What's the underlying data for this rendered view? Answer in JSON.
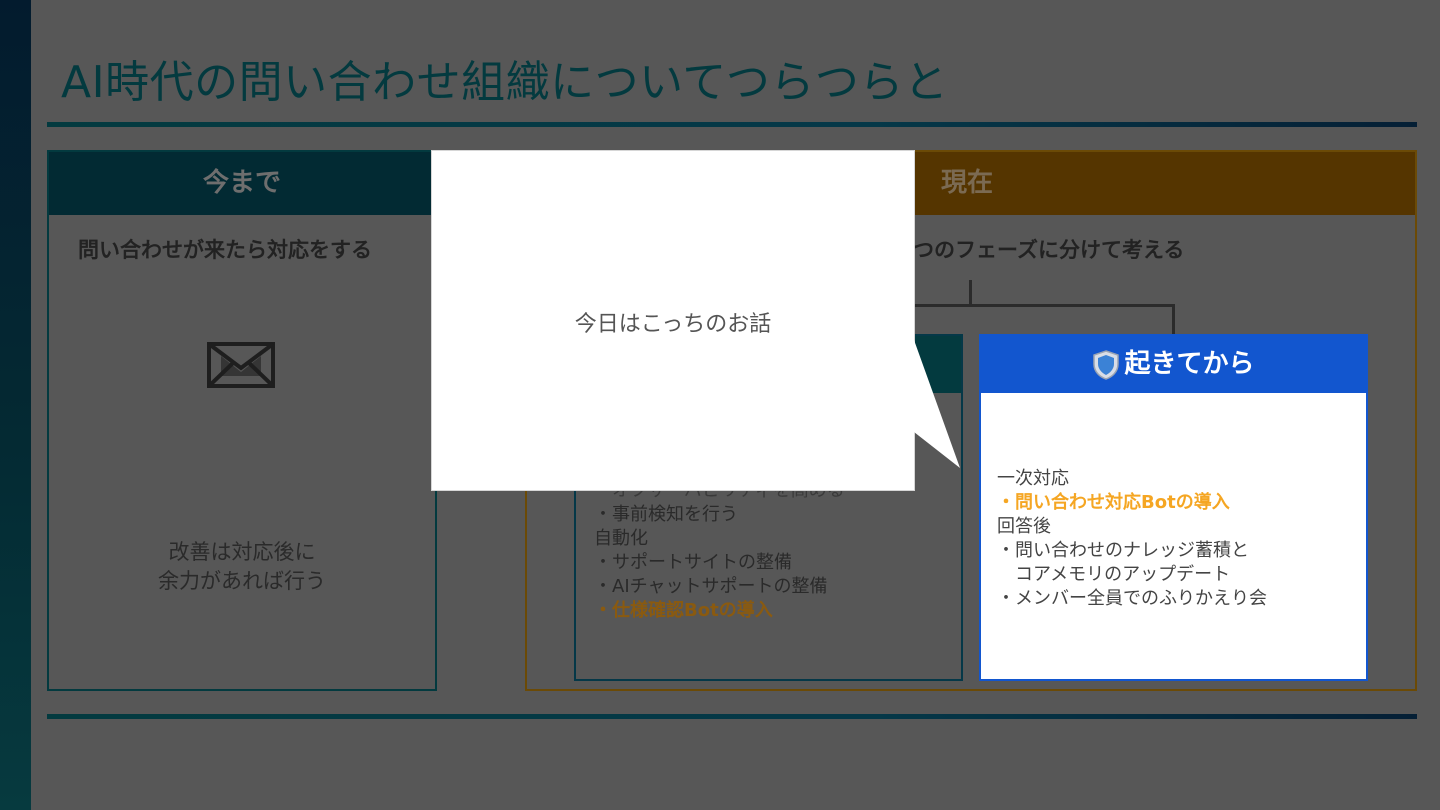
{
  "slide": {
    "title": "AI時代の問い合わせ組織についてつらつらと"
  },
  "past": {
    "header": "今まで",
    "subtitle": "問い合わせが来たら対応をする",
    "icon": "envelope-icon",
    "note_lines": [
      "改善は対応後に",
      "余力があれば行う"
    ]
  },
  "now": {
    "header": "現在",
    "subtitle": "つのフェーズに分けて考える",
    "before_phase": {
      "lines_partial": [
        "・オブザーバビリティを高める",
        "・事前検知を行う"
      ],
      "automation_heading": "自動化",
      "automation_items": [
        "・サポートサイトの整備",
        "・AIチャットサポートの整備"
      ],
      "highlight_item": "・仕様確認Botの導入"
    },
    "after_phase": {
      "header": "起きてから",
      "icon": "shield-icon",
      "first_response_heading": "一次対応",
      "first_response_highlight": "・問い合わせ対応Botの導入",
      "post_answer_heading": "回答後",
      "post_answer_items": [
        "・問い合わせのナレッジ蓄積と",
        "　コアメモリのアップデート",
        "・メンバー全員でのふりかえり会"
      ]
    }
  },
  "callout": {
    "text": "今日はこっちのお話"
  },
  "colors": {
    "teal_dark": "#033a3f",
    "brown": "#553500",
    "blue": "#1256cf",
    "highlight_orange": "#f5a623"
  }
}
